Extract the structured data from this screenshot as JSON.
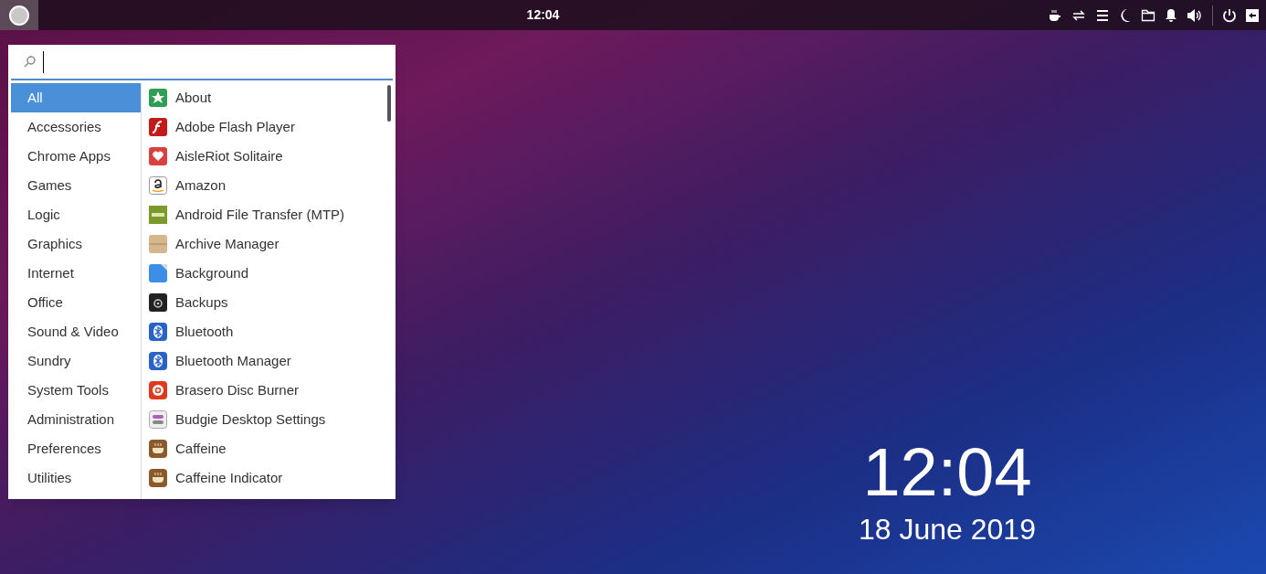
{
  "top_bar": {
    "clock": "12:04"
  },
  "menu": {
    "categories": [
      {
        "label": "All",
        "selected": true
      },
      {
        "label": "Accessories",
        "selected": false
      },
      {
        "label": "Chrome Apps",
        "selected": false
      },
      {
        "label": "Games",
        "selected": false
      },
      {
        "label": "Logic",
        "selected": false
      },
      {
        "label": "Graphics",
        "selected": false
      },
      {
        "label": "Internet",
        "selected": false
      },
      {
        "label": "Office",
        "selected": false
      },
      {
        "label": "Sound & Video",
        "selected": false
      },
      {
        "label": "Sundry",
        "selected": false
      },
      {
        "label": "System Tools",
        "selected": false
      },
      {
        "label": "Administration",
        "selected": false
      },
      {
        "label": "Preferences",
        "selected": false
      },
      {
        "label": "Utilities",
        "selected": false
      }
    ],
    "apps": [
      {
        "label": "About",
        "kind": "star"
      },
      {
        "label": "Adobe Flash Player",
        "kind": "flash"
      },
      {
        "label": "AisleRiot Solitaire",
        "kind": "heart"
      },
      {
        "label": "Amazon",
        "kind": "amazon"
      },
      {
        "label": "Android File Transfer (MTP)",
        "kind": "aft"
      },
      {
        "label": "Archive Manager",
        "kind": "archive"
      },
      {
        "label": "Background",
        "kind": "background"
      },
      {
        "label": "Backups",
        "kind": "safe"
      },
      {
        "label": "Bluetooth",
        "kind": "bluetooth"
      },
      {
        "label": "Bluetooth Manager",
        "kind": "bluetooth"
      },
      {
        "label": "Brasero Disc Burner",
        "kind": "disc"
      },
      {
        "label": "Budgie Desktop Settings",
        "kind": "toggles"
      },
      {
        "label": "Caffeine",
        "kind": "cup"
      },
      {
        "label": "Caffeine Indicator",
        "kind": "cup"
      }
    ]
  },
  "desktop_clock": {
    "time": "12:04",
    "date": "18 June 2019"
  }
}
